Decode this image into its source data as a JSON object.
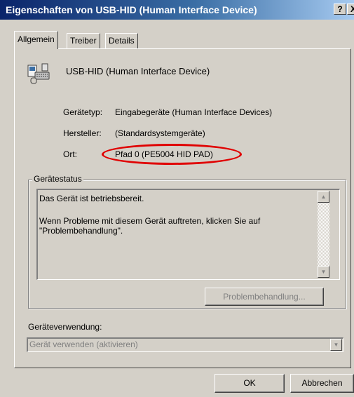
{
  "window": {
    "title": "Eigenschaften von USB-HID (Human Interface Device)",
    "help_button": "?",
    "close_button": "X"
  },
  "tabs": [
    "Allgemein",
    "Treiber",
    "Details"
  ],
  "device": {
    "name": "USB-HID (Human Interface Device)",
    "properties": [
      {
        "label": "Gerätetyp:",
        "value": "Eingabegeräte (Human Interface Devices)"
      },
      {
        "label": "Hersteller:",
        "value": "(Standardsystemgeräte)"
      },
      {
        "label": "Ort:",
        "value": "Pfad 0 (PE5004 HID PAD)"
      }
    ]
  },
  "status": {
    "group_label": "Gerätestatus",
    "lines": [
      "Das Gerät ist betriebsbereit.",
      "Wenn Probleme mit diesem Gerät auftreten, klicken Sie auf",
      "\"Problembehandlung\"."
    ],
    "problem_button": "Problembehandlung..."
  },
  "usage": {
    "label": "Geräteverwendung:",
    "selected": "Gerät verwenden (aktivieren)"
  },
  "buttons": {
    "ok": "OK",
    "cancel": "Abbrechen"
  },
  "colors": {
    "title_bar": "#0a246a",
    "dialog_background": "#d4d0c8",
    "highlight_ellipse": "#e00000"
  }
}
